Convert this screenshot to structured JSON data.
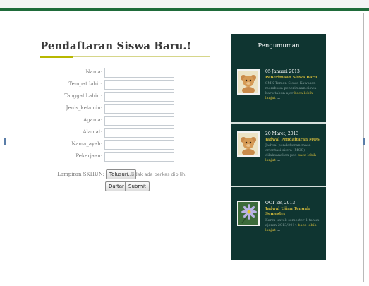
{
  "form": {
    "title": "Pendaftaran Siswa Baru.!",
    "fields": [
      {
        "label": "Nama:"
      },
      {
        "label": "Tempat lahir:"
      },
      {
        "label": "Tanggal Lahir :"
      },
      {
        "label": "Jenis_kelamin:"
      },
      {
        "label": "Agama:"
      },
      {
        "label": "Alamat:"
      },
      {
        "label": "Nama_ayah:"
      },
      {
        "label": "Pekerjaan:"
      }
    ],
    "file_label": "Lampiran SKHUN:",
    "file_button": "Telusuri...",
    "file_status": "Tidak ada berkas dipilih.",
    "daftar_button": "Daftar",
    "submit_button": "Submit"
  },
  "sidebar": {
    "title": "Pengumuman",
    "items": [
      {
        "date": "05 Januari 2013",
        "headline": "Penerimaan Siswa Baru",
        "excerpt": "SMK Taman Siswa Kawasan membuka penerimaan siswa baru tahun ajar",
        "more": "baca lebih lanjut",
        "ellipsis": "...",
        "icon": "teddy-bear-icon"
      },
      {
        "date": "20 Maret, 2013",
        "headline": "Jadwal Pendaftaran MOS",
        "excerpt": "Jadwal pendaftaran masa orientasi siswa (MOS) dilaksanakan pad",
        "more": "baca lebih lanjut",
        "ellipsis": "...",
        "icon": "teddy-bear-icon"
      },
      {
        "date": "OCT 28, 2013",
        "headline": "Jadwal Ujian Tengah Semester",
        "excerpt": "Kartu untuk semester 1 tahun ajaran 2013/2014",
        "more": "baca lebih lanjut",
        "ellipsis": "...",
        "icon": "flower-icon"
      }
    ]
  }
}
